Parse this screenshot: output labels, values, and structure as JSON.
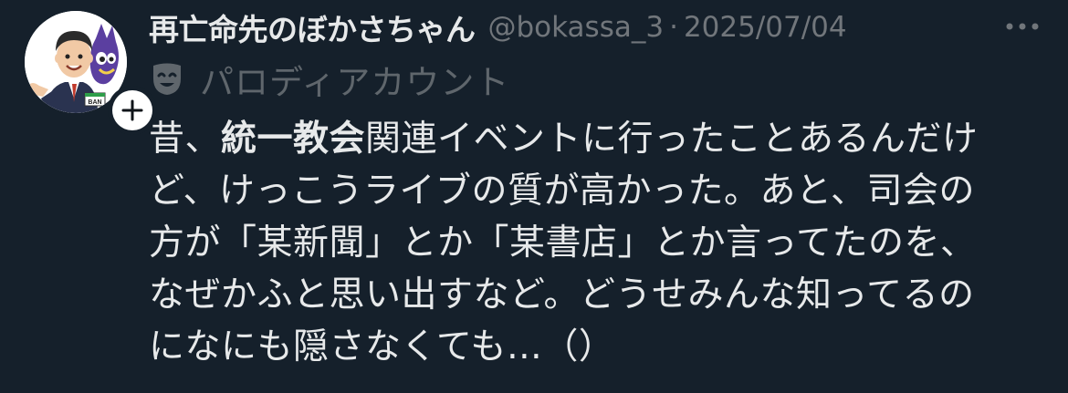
{
  "tweet": {
    "display_name": "再亡命先のぼかさちゃん",
    "handle": "@bokassa_3",
    "separator": "·",
    "date": "2025/07/04",
    "parody_label": "パロディアカウント",
    "avatar_badge_text": "BAN",
    "follow_icon": "plus-icon",
    "more_icon": "more-icon",
    "mask_icon": "theater-mask-icon",
    "text_lines": [
      {
        "a": "昔、",
        "b": "統一教会",
        "c": "関連イベントに行ったことあるんだけ"
      },
      {
        "a": "ど、けっこうライブの質が高かった。あと、司会の"
      },
      {
        "a": "方が「某新聞」とか「某書店」とか言ってたのを、"
      },
      {
        "a": "なぜかふと思い出すなど。どうせみんな知ってるの"
      },
      {
        "a": "になにも隠さなくても…（）"
      }
    ]
  },
  "colors": {
    "background": "#15202b",
    "text_primary": "#e7e9ea",
    "text_secondary": "#71767b"
  }
}
